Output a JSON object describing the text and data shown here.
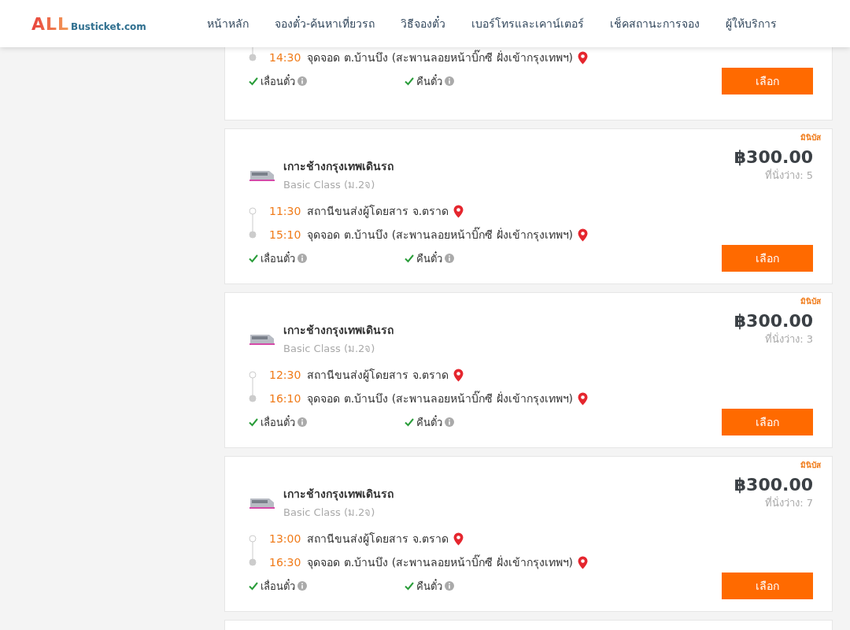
{
  "header": {
    "logo": {
      "main": "ALL",
      "sub": "Busticket.com"
    },
    "nav": [
      {
        "label": "หน้าหลัก"
      },
      {
        "label": "จองตั๋ว-ค้นหาเที่ยวรถ"
      },
      {
        "label": "วิธีจองตั๋ว"
      },
      {
        "label": "เบอร์โทรและเคาน์เตอร์"
      },
      {
        "label": "เช็คสถานะการจอง"
      },
      {
        "label": "ผู้ให้บริการ"
      }
    ]
  },
  "trips": [
    {
      "kind": "cut",
      "stops": [
        {
          "kind": "arrive",
          "time": "14:30",
          "place": "จุดจอด ต.บ้านบึง (สะพานลอยหน้าบิ๊กซี ฝั่งเข้ากรุงเทพฯ)"
        }
      ],
      "features": [
        {
          "label": "เลื่อนตั๋ว",
          "available": true
        },
        {
          "label": "คืนตั๋ว",
          "available": true
        }
      ],
      "button": "เลือก"
    },
    {
      "kind": "full",
      "badge": "มินิบัส",
      "operator": "เกาะช้างกรุงเทพเดินรถ",
      "class": "Basic Class (ม.2จ)",
      "price": "฿300.00",
      "seats": "ที่นั่งว่าง: 5",
      "stops": [
        {
          "kind": "depart",
          "time": "11:30",
          "place": "สถานีขนส่งผู้โดยสาร จ.ตราด"
        },
        {
          "kind": "arrive",
          "time": "15:10",
          "place": "จุดจอด ต.บ้านบึง (สะพานลอยหน้าบิ๊กซี ฝั่งเข้ากรุงเทพฯ)"
        }
      ],
      "features": [
        {
          "label": "เลื่อนตั๋ว",
          "available": true
        },
        {
          "label": "คืนตั๋ว",
          "available": true
        }
      ],
      "button": "เลือก"
    },
    {
      "kind": "full",
      "badge": "มินิบัส",
      "operator": "เกาะช้างกรุงเทพเดินรถ",
      "class": "Basic Class (ม.2จ)",
      "price": "฿300.00",
      "seats": "ที่นั่งว่าง: 3",
      "stops": [
        {
          "kind": "depart",
          "time": "12:30",
          "place": "สถานีขนส่งผู้โดยสาร จ.ตราด"
        },
        {
          "kind": "arrive",
          "time": "16:10",
          "place": "จุดจอด ต.บ้านบึง (สะพานลอยหน้าบิ๊กซี ฝั่งเข้ากรุงเทพฯ)"
        }
      ],
      "features": [
        {
          "label": "เลื่อนตั๋ว",
          "available": true
        },
        {
          "label": "คืนตั๋ว",
          "available": true
        }
      ],
      "button": "เลือก"
    },
    {
      "kind": "full",
      "badge": "มินิบัส",
      "operator": "เกาะช้างกรุงเทพเดินรถ",
      "class": "Basic Class (ม.2จ)",
      "price": "฿300.00",
      "seats": "ที่นั่งว่าง: 7",
      "stops": [
        {
          "kind": "depart",
          "time": "13:00",
          "place": "สถานีขนส่งผู้โดยสาร จ.ตราด"
        },
        {
          "kind": "arrive",
          "time": "16:30",
          "place": "จุดจอด ต.บ้านบึง (สะพานลอยหน้าบิ๊กซี ฝั่งเข้ากรุงเทพฯ)"
        }
      ],
      "features": [
        {
          "label": "เลื่อนตั๋ว",
          "available": true
        },
        {
          "label": "คืนตั๋ว",
          "available": true
        }
      ],
      "button": "เลือก"
    }
  ]
}
